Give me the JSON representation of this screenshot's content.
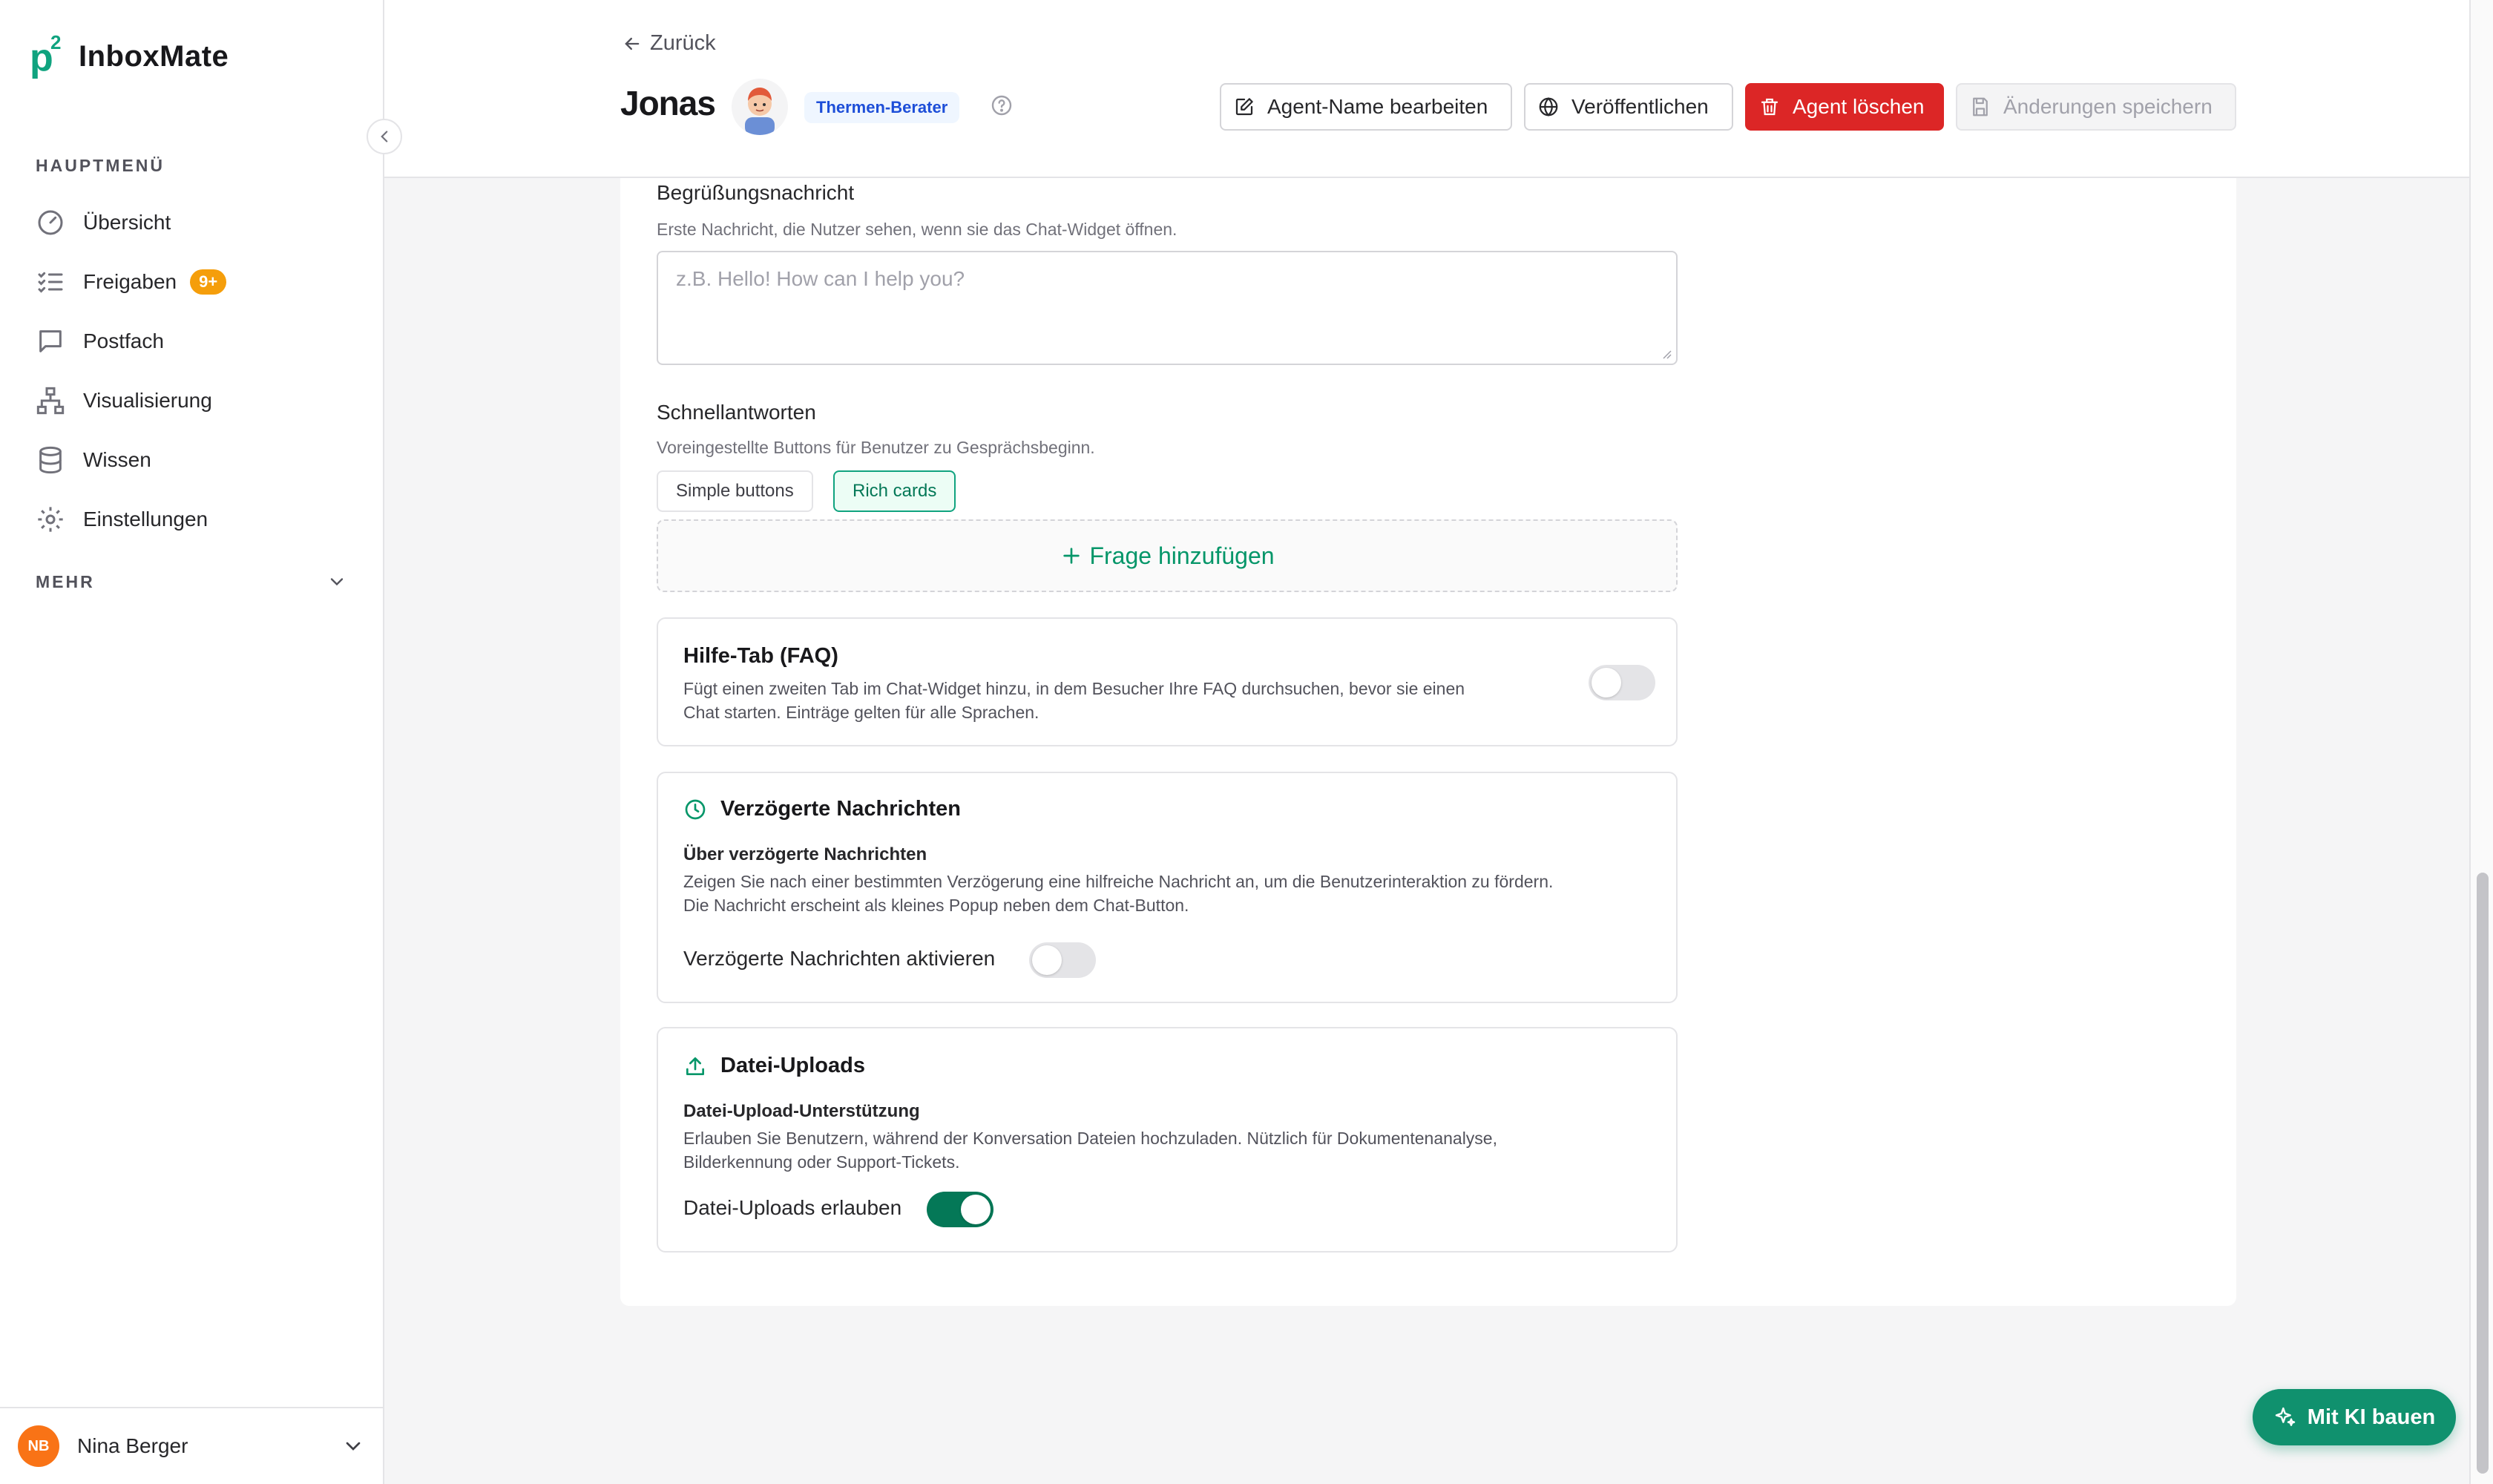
{
  "app": {
    "logo_mark": "p",
    "logo_sup": "2",
    "name": "InboxMate"
  },
  "sidebar": {
    "section_main": "HAUPTMENÜ",
    "items": [
      {
        "label": "Übersicht",
        "icon": "gauge-icon"
      },
      {
        "label": "Freigaben",
        "icon": "checklist-icon",
        "badge": "9+"
      },
      {
        "label": "Postfach",
        "icon": "message-square-icon"
      },
      {
        "label": "Visualisierung",
        "icon": "network-icon"
      },
      {
        "label": "Wissen",
        "icon": "database-icon"
      },
      {
        "label": "Einstellungen",
        "icon": "gear-icon"
      }
    ],
    "section_more": "MEHR"
  },
  "user": {
    "initials": "NB",
    "name": "Nina Berger"
  },
  "header": {
    "back_label": "Zurück",
    "agent_name": "Jonas",
    "role_badge": "Thermen-Berater",
    "edit_name_label": "Agent-Name bearbeiten",
    "publish_label": "Veröffentlichen",
    "delete_label": "Agent löschen",
    "save_label": "Änderungen speichern"
  },
  "greeting": {
    "title": "Begrüßungsnachricht",
    "subtitle": "Erste Nachricht, die Nutzer sehen, wenn sie das Chat-Widget öffnen.",
    "placeholder": "z.B. Hello! How can I help you?",
    "value": ""
  },
  "quick_replies": {
    "title": "Schnellantworten",
    "subtitle": "Voreingestellte Buttons für Benutzer zu Gesprächsbeginn.",
    "mode_simple": "Simple buttons",
    "mode_rich": "Rich cards",
    "selected_mode": "Rich cards",
    "add_label": "Frage hinzufügen"
  },
  "faq_tab": {
    "title": "Hilfe-Tab (FAQ)",
    "text_line1": "Fügt einen zweiten Tab im Chat-Widget hinzu, in dem Besucher Ihre FAQ durchsuchen, bevor sie einen",
    "text_line2": "Chat starten. Einträge gelten für alle Sprachen.",
    "enabled": false
  },
  "delayed": {
    "title": "Verzögerte Nachrichten",
    "subtitle": "Über verzögerte Nachrichten",
    "text_line1": "Zeigen Sie nach einer bestimmten Verzögerung eine hilfreiche Nachricht an, um die Benutzerinteraktion zu fördern.",
    "text_line2": "Die Nachricht erscheint als kleines Popup neben dem Chat-Button.",
    "toggle_label": "Verzögerte Nachrichten aktivieren",
    "enabled": false
  },
  "uploads": {
    "title": "Datei-Uploads",
    "subtitle": "Datei-Upload-Unterstützung",
    "text_line1": "Erlauben Sie Benutzern, während der Konversation Dateien hochzuladen. Nützlich für Dokumentenanalyse,",
    "text_line2": "Bilderkennung oder Support-Tickets.",
    "toggle_label": "Datei-Uploads erlauben",
    "enabled": true
  },
  "ki_button": {
    "label": "Mit KI bauen"
  },
  "colors": {
    "brand": "#10a37f",
    "danger": "#dc2626",
    "badge": "#f59e0b",
    "role_badge_text": "#1d4ed8"
  }
}
